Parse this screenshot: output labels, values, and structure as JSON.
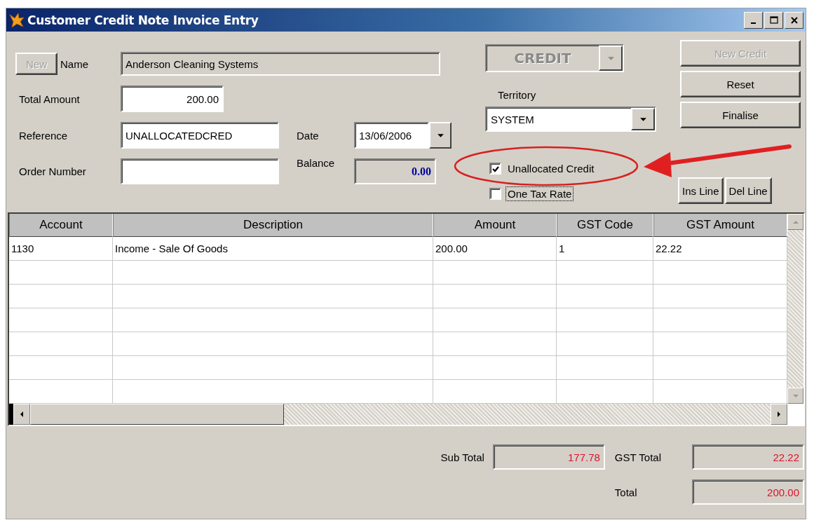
{
  "window": {
    "title": "Customer Credit Note Invoice Entry"
  },
  "new_button": {
    "label": "New",
    "disabled": true
  },
  "name": {
    "label": "Name",
    "value": "Anderson Cleaning Systems",
    "disabled": true
  },
  "total_amount": {
    "label": "Total Amount",
    "value": "200.00"
  },
  "reference": {
    "label": "Reference",
    "value": "UNALLOCATEDCRED"
  },
  "date": {
    "label": "Date",
    "value": "13/06/2006"
  },
  "order_number": {
    "label": "Order Number"
  },
  "balance": {
    "label": "Balance",
    "value": "0.00"
  },
  "type_combo": {
    "value": "CREDIT",
    "disabled": true
  },
  "territory": {
    "label": "Territory",
    "value": "SYSTEM"
  },
  "checkboxes": [
    {
      "label": "Unallocated Credit",
      "checked": true,
      "focused": false
    },
    {
      "label": "One Tax Rate",
      "checked": false,
      "focused": true
    }
  ],
  "side_buttons": [
    {
      "label": "New Credit",
      "disabled": true
    },
    {
      "label": "Reset",
      "disabled": false
    },
    {
      "label": "Finalise",
      "disabled": false
    }
  ],
  "line_buttons": [
    {
      "label": "Ins Line",
      "disabled": false
    },
    {
      "label": "Del Line",
      "disabled": false
    }
  ],
  "table": {
    "columns": [
      "Account",
      "Description",
      "Amount",
      "GST Code",
      "GST Amount"
    ],
    "rows": [
      [
        "1130",
        "Income - Sale Of Goods",
        "200.00",
        "1",
        "22.22"
      ]
    ]
  },
  "totals": [
    {
      "label": "Sub Total",
      "value": "177.78"
    },
    {
      "label": "GST Total",
      "value": "22.22"
    },
    {
      "label": "Total",
      "value": "200.00"
    }
  ]
}
